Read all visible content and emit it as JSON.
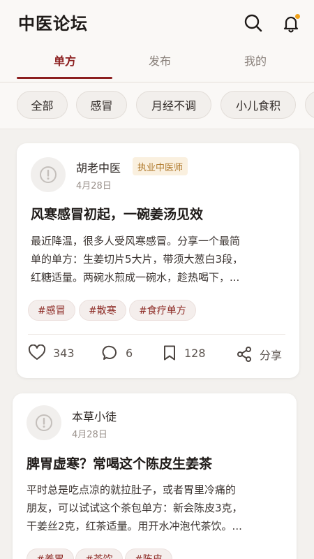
{
  "header": {
    "title": "中医论坛",
    "icons": {
      "search": "search-icon",
      "notifications": "bell-icon"
    },
    "notification_dot_color": "#f0a21b"
  },
  "tabs": [
    {
      "label": "单方",
      "active": true
    },
    {
      "label": "发布",
      "active": false
    },
    {
      "label": "我的",
      "active": false
    }
  ],
  "categories": [
    {
      "label": "全部"
    },
    {
      "label": "感冒"
    },
    {
      "label": "月经不调"
    },
    {
      "label": "小儿食积"
    }
  ],
  "posts": [
    {
      "author": "胡老中医",
      "badge": "执业中医师",
      "date": "4月28日",
      "title": "风寒感冒初起，一碗姜汤见效",
      "excerpt_lines": [
        "最近降温，很多人受风寒感冒。分享一个最简",
        "单的单方：生姜切片5大片，带须大葱白3段，",
        "红糖适量。两碗水煎成一碗水，趁热喝下，..."
      ],
      "tags": [
        "#感冒",
        "#散寒",
        "#食疗单方"
      ],
      "likes": "343",
      "comments": "6",
      "bookmarks": "128",
      "share_label": "分享"
    },
    {
      "author": "本草小徒",
      "date": "4月28日",
      "title": "脾胃虚寒？常喝这个陈皮生姜茶",
      "excerpt_lines": [
        "平时总是吃点凉的就拉肚子，或者胃里冷痛的",
        "朋友，可以试试这个茶包单方：新会陈皮3克，",
        "干姜丝2克，红茶适量。用开水冲泡代茶饮。..."
      ],
      "tags": [
        "#养胃",
        "#茶饮",
        "#陈皮"
      ]
    }
  ],
  "colors": {
    "accent": "#8c1f1f",
    "badge_bg": "#faf0df",
    "badge_text": "#b07a2d",
    "tag_text": "#8c2a24"
  }
}
